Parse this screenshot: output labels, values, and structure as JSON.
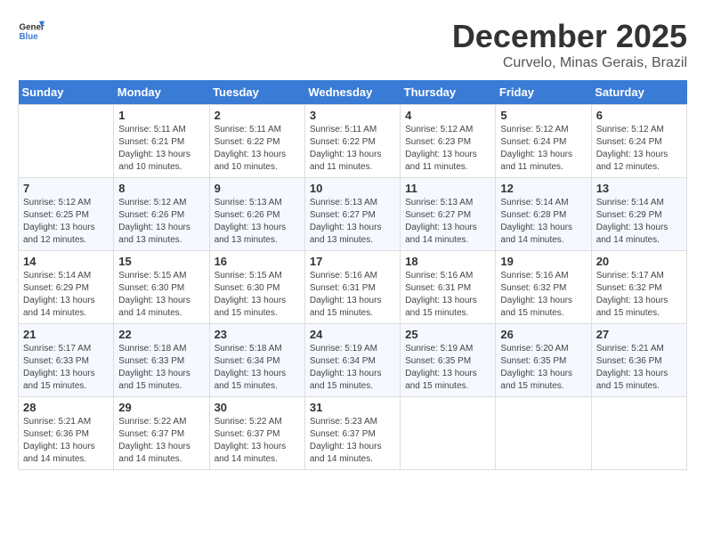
{
  "header": {
    "logo_general": "General",
    "logo_blue": "Blue",
    "month_year": "December 2025",
    "location": "Curvelo, Minas Gerais, Brazil"
  },
  "weekdays": [
    "Sunday",
    "Monday",
    "Tuesday",
    "Wednesday",
    "Thursday",
    "Friday",
    "Saturday"
  ],
  "weeks": [
    [
      {
        "day": "",
        "sunrise": "",
        "sunset": "",
        "daylight": ""
      },
      {
        "day": "1",
        "sunrise": "Sunrise: 5:11 AM",
        "sunset": "Sunset: 6:21 PM",
        "daylight": "Daylight: 13 hours and 10 minutes."
      },
      {
        "day": "2",
        "sunrise": "Sunrise: 5:11 AM",
        "sunset": "Sunset: 6:22 PM",
        "daylight": "Daylight: 13 hours and 10 minutes."
      },
      {
        "day": "3",
        "sunrise": "Sunrise: 5:11 AM",
        "sunset": "Sunset: 6:22 PM",
        "daylight": "Daylight: 13 hours and 11 minutes."
      },
      {
        "day": "4",
        "sunrise": "Sunrise: 5:12 AM",
        "sunset": "Sunset: 6:23 PM",
        "daylight": "Daylight: 13 hours and 11 minutes."
      },
      {
        "day": "5",
        "sunrise": "Sunrise: 5:12 AM",
        "sunset": "Sunset: 6:24 PM",
        "daylight": "Daylight: 13 hours and 11 minutes."
      },
      {
        "day": "6",
        "sunrise": "Sunrise: 5:12 AM",
        "sunset": "Sunset: 6:24 PM",
        "daylight": "Daylight: 13 hours and 12 minutes."
      }
    ],
    [
      {
        "day": "7",
        "sunrise": "Sunrise: 5:12 AM",
        "sunset": "Sunset: 6:25 PM",
        "daylight": "Daylight: 13 hours and 12 minutes."
      },
      {
        "day": "8",
        "sunrise": "Sunrise: 5:12 AM",
        "sunset": "Sunset: 6:26 PM",
        "daylight": "Daylight: 13 hours and 13 minutes."
      },
      {
        "day": "9",
        "sunrise": "Sunrise: 5:13 AM",
        "sunset": "Sunset: 6:26 PM",
        "daylight": "Daylight: 13 hours and 13 minutes."
      },
      {
        "day": "10",
        "sunrise": "Sunrise: 5:13 AM",
        "sunset": "Sunset: 6:27 PM",
        "daylight": "Daylight: 13 hours and 13 minutes."
      },
      {
        "day": "11",
        "sunrise": "Sunrise: 5:13 AM",
        "sunset": "Sunset: 6:27 PM",
        "daylight": "Daylight: 13 hours and 14 minutes."
      },
      {
        "day": "12",
        "sunrise": "Sunrise: 5:14 AM",
        "sunset": "Sunset: 6:28 PM",
        "daylight": "Daylight: 13 hours and 14 minutes."
      },
      {
        "day": "13",
        "sunrise": "Sunrise: 5:14 AM",
        "sunset": "Sunset: 6:29 PM",
        "daylight": "Daylight: 13 hours and 14 minutes."
      }
    ],
    [
      {
        "day": "14",
        "sunrise": "Sunrise: 5:14 AM",
        "sunset": "Sunset: 6:29 PM",
        "daylight": "Daylight: 13 hours and 14 minutes."
      },
      {
        "day": "15",
        "sunrise": "Sunrise: 5:15 AM",
        "sunset": "Sunset: 6:30 PM",
        "daylight": "Daylight: 13 hours and 14 minutes."
      },
      {
        "day": "16",
        "sunrise": "Sunrise: 5:15 AM",
        "sunset": "Sunset: 6:30 PM",
        "daylight": "Daylight: 13 hours and 15 minutes."
      },
      {
        "day": "17",
        "sunrise": "Sunrise: 5:16 AM",
        "sunset": "Sunset: 6:31 PM",
        "daylight": "Daylight: 13 hours and 15 minutes."
      },
      {
        "day": "18",
        "sunrise": "Sunrise: 5:16 AM",
        "sunset": "Sunset: 6:31 PM",
        "daylight": "Daylight: 13 hours and 15 minutes."
      },
      {
        "day": "19",
        "sunrise": "Sunrise: 5:16 AM",
        "sunset": "Sunset: 6:32 PM",
        "daylight": "Daylight: 13 hours and 15 minutes."
      },
      {
        "day": "20",
        "sunrise": "Sunrise: 5:17 AM",
        "sunset": "Sunset: 6:32 PM",
        "daylight": "Daylight: 13 hours and 15 minutes."
      }
    ],
    [
      {
        "day": "21",
        "sunrise": "Sunrise: 5:17 AM",
        "sunset": "Sunset: 6:33 PM",
        "daylight": "Daylight: 13 hours and 15 minutes."
      },
      {
        "day": "22",
        "sunrise": "Sunrise: 5:18 AM",
        "sunset": "Sunset: 6:33 PM",
        "daylight": "Daylight: 13 hours and 15 minutes."
      },
      {
        "day": "23",
        "sunrise": "Sunrise: 5:18 AM",
        "sunset": "Sunset: 6:34 PM",
        "daylight": "Daylight: 13 hours and 15 minutes."
      },
      {
        "day": "24",
        "sunrise": "Sunrise: 5:19 AM",
        "sunset": "Sunset: 6:34 PM",
        "daylight": "Daylight: 13 hours and 15 minutes."
      },
      {
        "day": "25",
        "sunrise": "Sunrise: 5:19 AM",
        "sunset": "Sunset: 6:35 PM",
        "daylight": "Daylight: 13 hours and 15 minutes."
      },
      {
        "day": "26",
        "sunrise": "Sunrise: 5:20 AM",
        "sunset": "Sunset: 6:35 PM",
        "daylight": "Daylight: 13 hours and 15 minutes."
      },
      {
        "day": "27",
        "sunrise": "Sunrise: 5:21 AM",
        "sunset": "Sunset: 6:36 PM",
        "daylight": "Daylight: 13 hours and 15 minutes."
      }
    ],
    [
      {
        "day": "28",
        "sunrise": "Sunrise: 5:21 AM",
        "sunset": "Sunset: 6:36 PM",
        "daylight": "Daylight: 13 hours and 14 minutes."
      },
      {
        "day": "29",
        "sunrise": "Sunrise: 5:22 AM",
        "sunset": "Sunset: 6:37 PM",
        "daylight": "Daylight: 13 hours and 14 minutes."
      },
      {
        "day": "30",
        "sunrise": "Sunrise: 5:22 AM",
        "sunset": "Sunset: 6:37 PM",
        "daylight": "Daylight: 13 hours and 14 minutes."
      },
      {
        "day": "31",
        "sunrise": "Sunrise: 5:23 AM",
        "sunset": "Sunset: 6:37 PM",
        "daylight": "Daylight: 13 hours and 14 minutes."
      },
      {
        "day": "",
        "sunrise": "",
        "sunset": "",
        "daylight": ""
      },
      {
        "day": "",
        "sunrise": "",
        "sunset": "",
        "daylight": ""
      },
      {
        "day": "",
        "sunrise": "",
        "sunset": "",
        "daylight": ""
      }
    ]
  ]
}
